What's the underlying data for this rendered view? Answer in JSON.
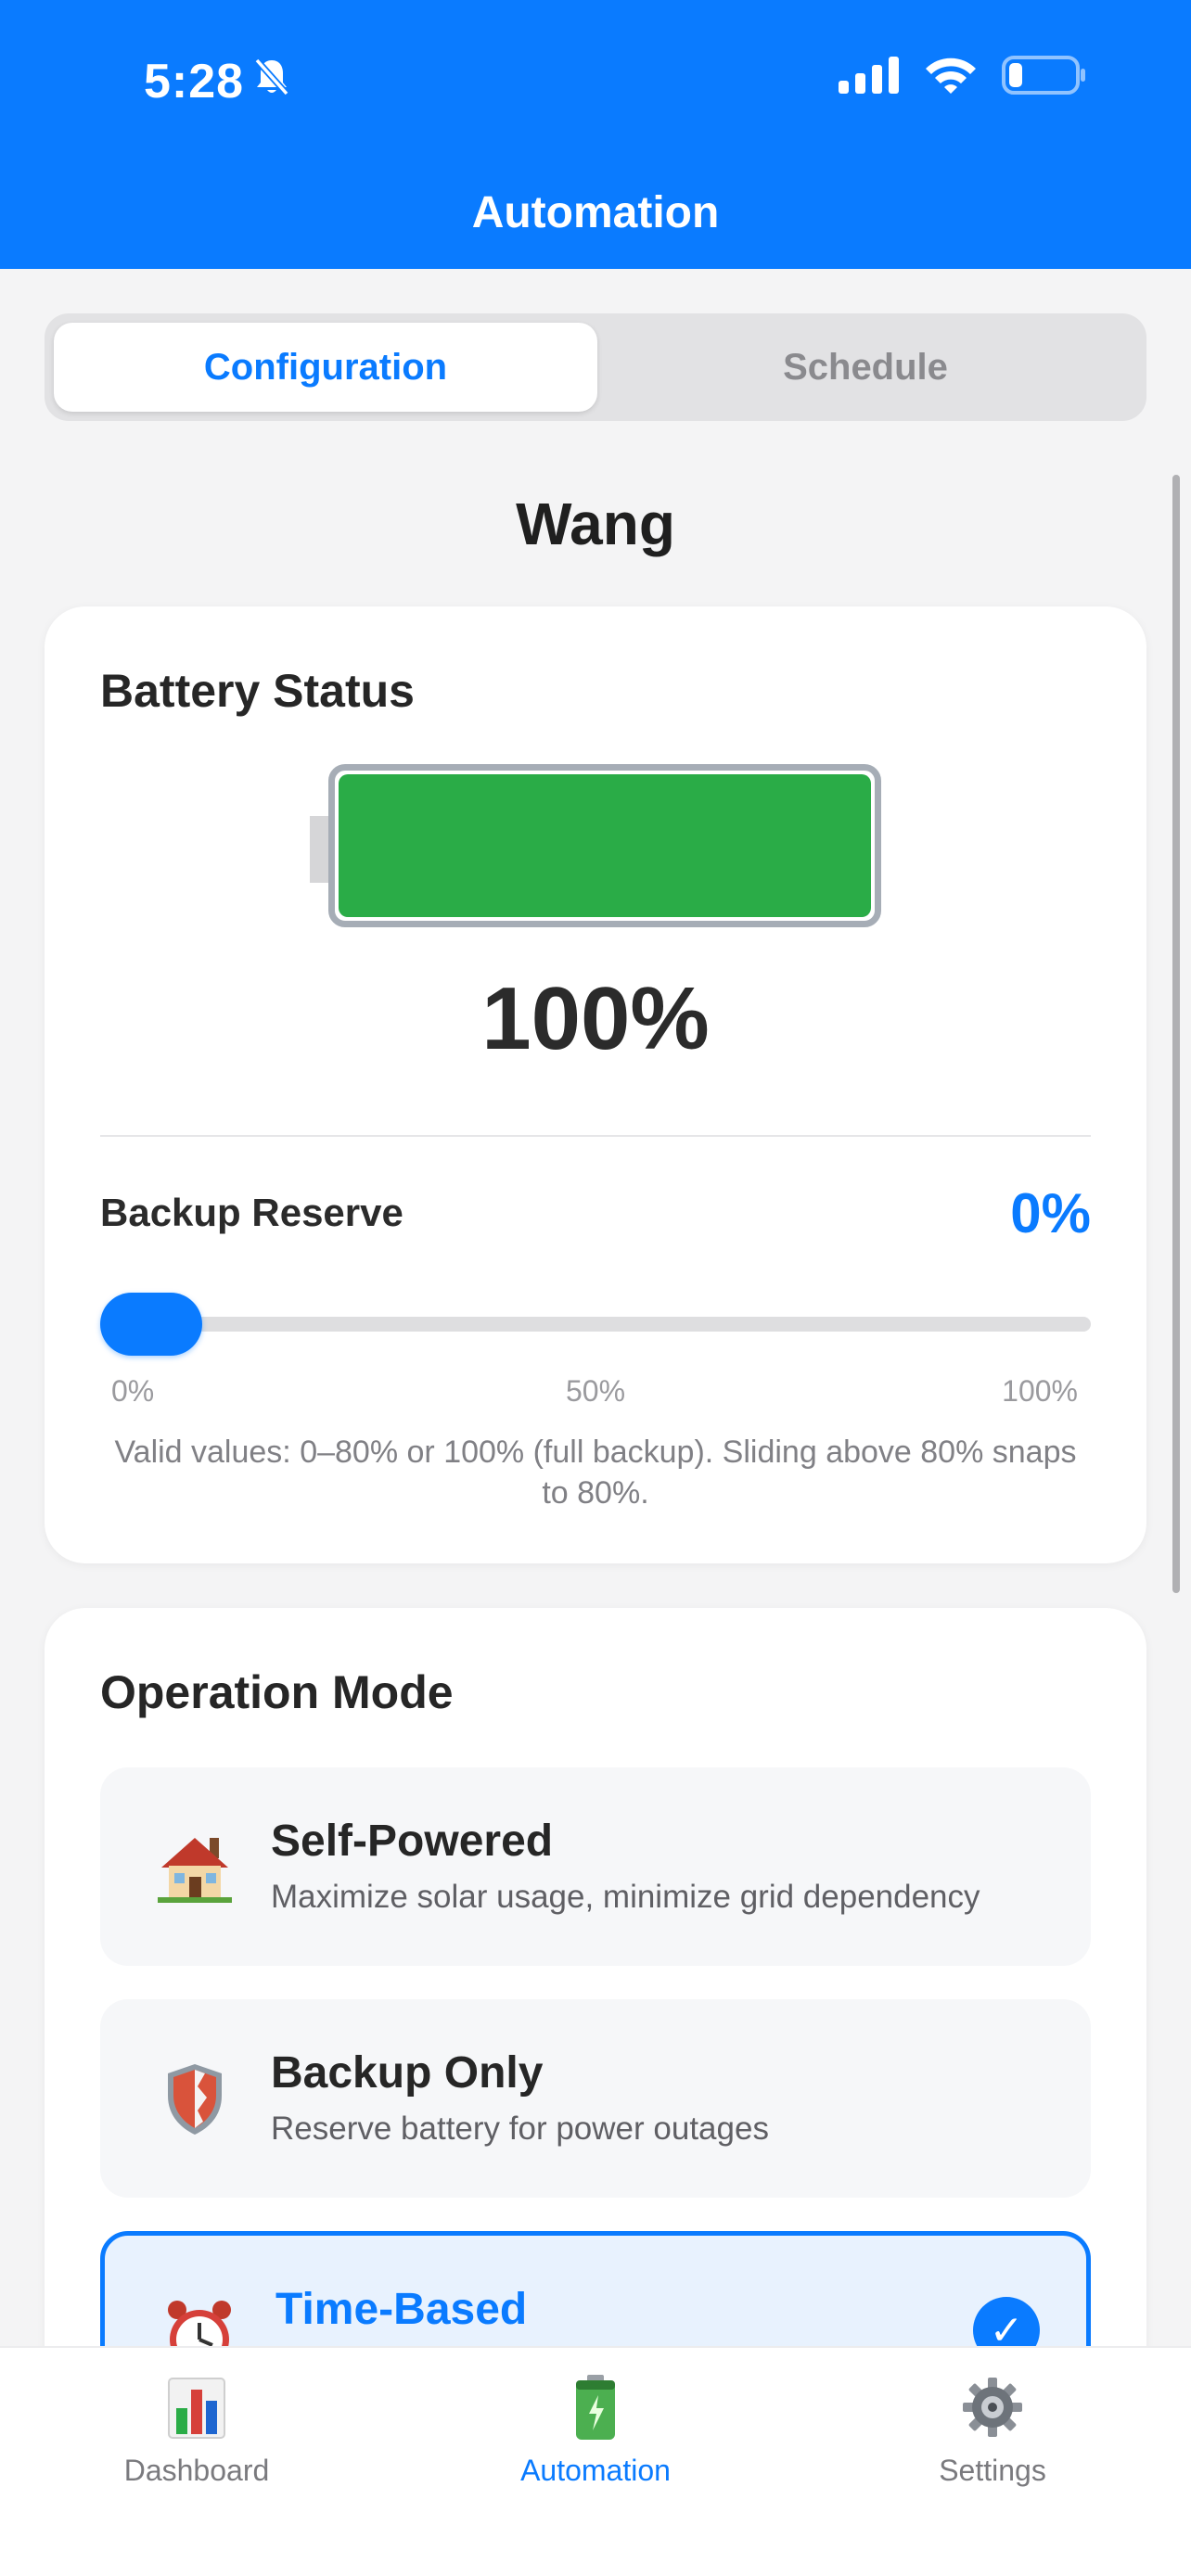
{
  "status_bar": {
    "time": "5:28"
  },
  "header": {
    "title": "Automation"
  },
  "segmented": {
    "configuration": "Configuration",
    "schedule": "Schedule"
  },
  "site": {
    "name": "Wang"
  },
  "battery": {
    "title": "Battery Status",
    "level_fraction": 1.0,
    "percent_text": "100%",
    "fill_color": "#2aac47"
  },
  "backup_reserve": {
    "label": "Backup Reserve",
    "value_text": "0%",
    "value": 0,
    "ticks": [
      "0%",
      "50%",
      "100%"
    ],
    "hint": "Valid values: 0–80% or 100% (full backup). Sliding above 80% snaps to 80%."
  },
  "operation_mode": {
    "title": "Operation Mode",
    "modes": [
      {
        "icon": "house-icon",
        "title": "Self-Powered",
        "desc": "Maximize solar usage, minimize grid dependency",
        "selected": false
      },
      {
        "icon": "shield-icon",
        "title": "Backup Only",
        "desc": "Reserve battery for power outages",
        "selected": false
      },
      {
        "icon": "alarm-clock-icon",
        "title": "Time-Based",
        "desc": "",
        "selected": true
      }
    ]
  },
  "tabbar": {
    "items": [
      {
        "icon": "bar-chart-icon",
        "label": "Dashboard"
      },
      {
        "icon": "battery-icon",
        "label": "Automation"
      },
      {
        "icon": "gear-icon",
        "label": "Settings"
      }
    ]
  },
  "colors": {
    "accent": "#0a7bff",
    "header": "#0a7bff",
    "battery_green": "#2aac47"
  }
}
